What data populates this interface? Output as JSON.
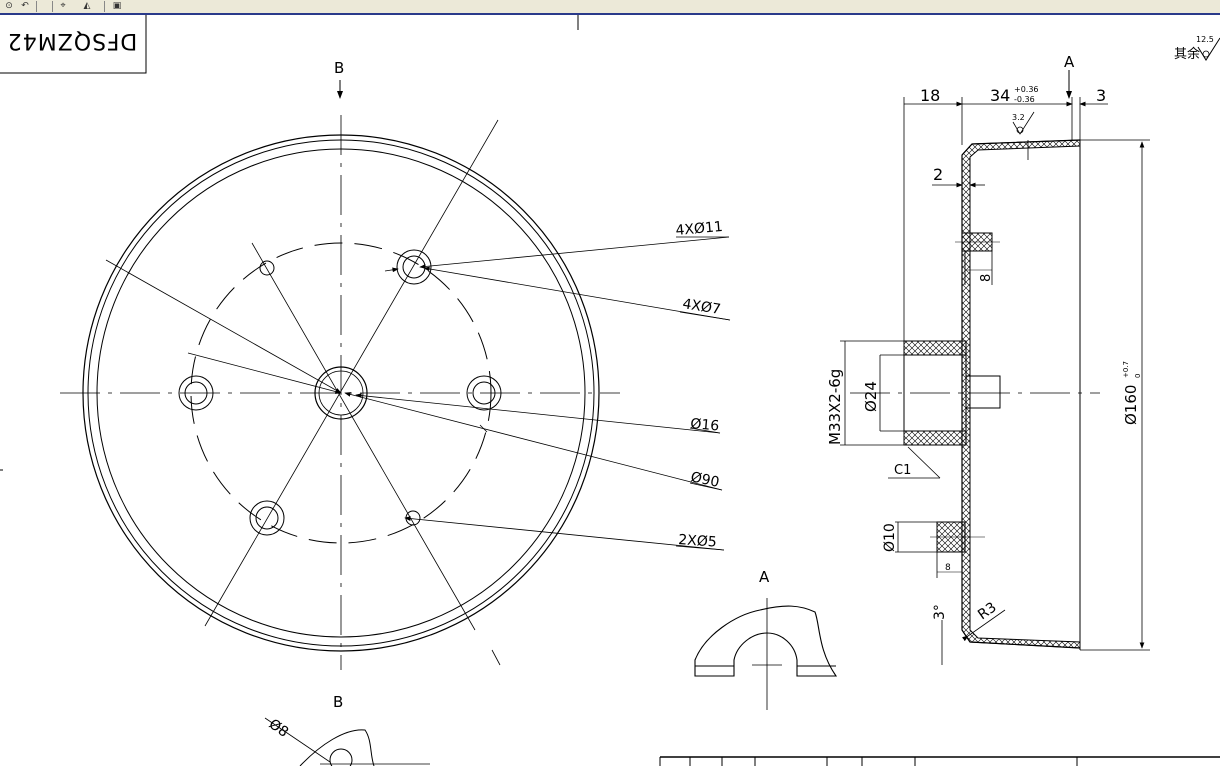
{
  "toolbar": {
    "icons": [
      "snap-icon",
      "undo-icon",
      "measure-icon",
      "layer-icon",
      "color-icon"
    ]
  },
  "drawing": {
    "code_label": "DFSQZM42",
    "roughness": {
      "label": "其余",
      "value": "12.5"
    },
    "front_view": {
      "section_mark": "B",
      "callouts": [
        "4XØ11",
        "4XØ7",
        "Ø16",
        "Ø90",
        "2XØ5"
      ]
    },
    "side_view": {
      "section_mark": "A",
      "dims": {
        "d18": "18",
        "d34": "34",
        "d34_upper": "+0.36",
        "d34_lower": "-0.36",
        "d3": "3",
        "d2": "2",
        "d8_upper": "8",
        "thread": "M33X2-6g",
        "d24": "Ø24",
        "c1": "C1",
        "d10": "Ø10",
        "d8_lower": "8",
        "angle3": "3°",
        "r3": "R3",
        "d160": "Ø160",
        "d160_upper": "+0.7",
        "d160_lower": "0",
        "roughness_local": "3.2"
      }
    },
    "detail_a": {
      "label": "A"
    },
    "detail_b": {
      "label": "B",
      "dim": "Ø8"
    }
  }
}
